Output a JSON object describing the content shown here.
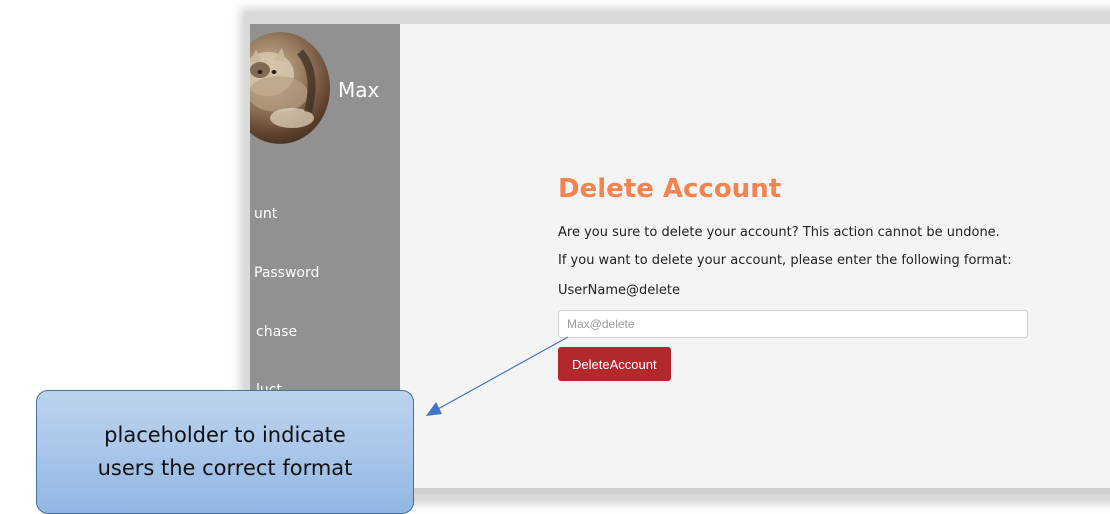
{
  "sidebar": {
    "user_name": "Max",
    "items": [
      {
        "label": "unt"
      },
      {
        "label": " Password"
      },
      {
        "label": "chase"
      },
      {
        "label": "luct"
      }
    ]
  },
  "main": {
    "title": "Delete Account",
    "warning_text": "Are you sure to delete your account? This action cannot be undone.",
    "instruction_text": "If you want to delete your account, please enter the following format:",
    "format_text": "UserName@delete",
    "input": {
      "value": "",
      "placeholder": "Max@delete"
    },
    "delete_button_label": "DeleteAccount"
  },
  "annotation": {
    "text_line1": "placeholder to indicate",
    "text_line2": "users the correct format"
  },
  "colors": {
    "sidebar_bg": "#919191",
    "title": "#f4834f",
    "button_bg": "#b3282d",
    "callout_fill": "#a9c6ea",
    "arrow": "#4472c4"
  },
  "icons": {
    "avatar": "cat-photo-avatar",
    "pointer": "arrow-pointer"
  }
}
